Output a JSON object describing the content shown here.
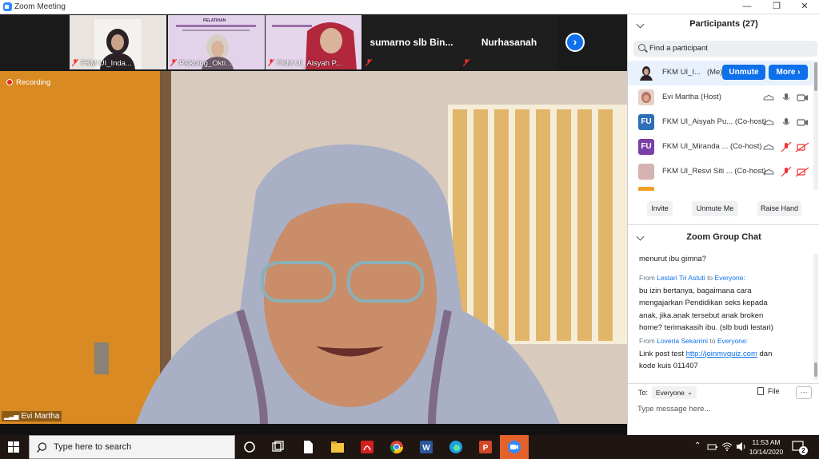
{
  "window": {
    "title": "Zoom Meeting",
    "controls": [
      "—",
      "❐",
      "✕"
    ]
  },
  "gallery": {
    "tiles": [
      {
        "name": "FKM UI_Inda..."
      },
      {
        "name": "Psikolog_Okti..."
      },
      {
        "name": "FKM UI_Aisyah P..."
      },
      {
        "name": "sumarno slb Bin..."
      },
      {
        "name": "Nurhasanah"
      }
    ],
    "slide_heading": "PELATIHAN"
  },
  "main": {
    "recording_label": "Recording",
    "speaker_name": "Evi Martha"
  },
  "participants": {
    "title": "Participants (27)",
    "search_placeholder": "Find a participant",
    "rows": [
      {
        "initials": "",
        "name": "FKM UI_I...",
        "role": "(Me)",
        "color": "#3b3b3b"
      },
      {
        "initials": "",
        "name": "Evi Martha",
        "role": "(Host)",
        "color": "#b9746a"
      },
      {
        "initials": "FU",
        "name": "FKM UI_Aisyah Pu...",
        "role": "(Co-host)",
        "color": "#2f6fb5"
      },
      {
        "initials": "FU",
        "name": "FKM UI_Miranda ...",
        "role": "(Co-host)",
        "color": "#7b3fa8"
      },
      {
        "initials": "",
        "name": "FKM UI_Resvi Siti ...",
        "role": "(Co-host)",
        "color": "#d6b3b0"
      }
    ],
    "unmute_label": "Unmute",
    "more_label": "More ›",
    "invite_label": "Invite",
    "unmute_me_label": "Unmute Me",
    "raise_hand_label": "Raise Hand"
  },
  "chat": {
    "title": "Zoom Group Chat",
    "partial_text": "menurut ibu gimna?",
    "messages": [
      {
        "from_word": "From",
        "sender": "Lestari Tri Astuti",
        "to_word": "to",
        "recipient": "Everyone:",
        "lines": [
          "bu izin bertanya, bagaimana cara",
          "mengajarkan Pendidikan seks kepada",
          "anak, jika.anak tersebut anak broken",
          "home? terimakasih ibu. (slb budi lestari)"
        ]
      },
      {
        "from_word": "From",
        "sender": "Loveria Sekarrini",
        "to_word": "to",
        "recipient": "Everyone:",
        "line1_pre": "Link post test ",
        "link": "http://joinmyquiz.com",
        "line1_post": " dan",
        "line2": "kode kuis 011407"
      }
    ],
    "to_label": "To:",
    "recipient_select": "Everyone",
    "file_label": "File",
    "more_label": "···",
    "input_placeholder": "Type message here..."
  },
  "taskbar": {
    "search_placeholder": "Type here to search",
    "time": "11:53 AM",
    "date": "10/14/2020",
    "notification_count": "2"
  }
}
